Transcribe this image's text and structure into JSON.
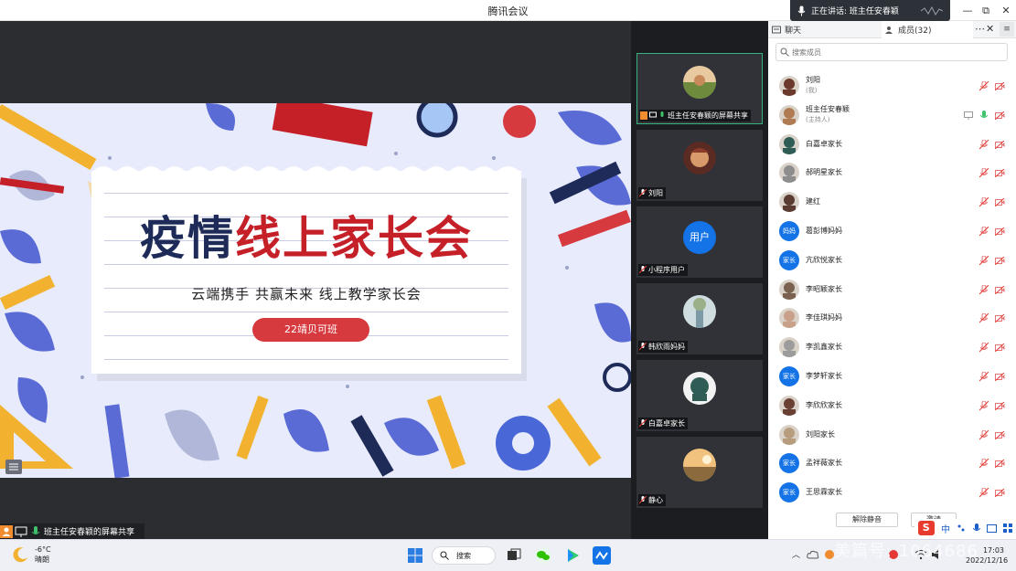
{
  "window": {
    "title": "腾讯会议",
    "speaking_label": "正在讲话: 班主任安春颖",
    "min_glyph": "—",
    "max_glyph": "⧉",
    "close_glyph": "✕"
  },
  "slide": {
    "title_part1": "疫情",
    "title_part2": "线上家长会",
    "subtitle": "云端携手 共赢未来 线上教学家长会",
    "pill": "22靖贝可班"
  },
  "share_bar": {
    "label": "班主任安春颖的屏幕共享"
  },
  "gallery": [
    {
      "name": "班主任安春颖的屏幕共享",
      "type": "photo",
      "color": "#c98a5b"
    },
    {
      "name": "刘阳",
      "type": "photo",
      "color": "#8a3b2a"
    },
    {
      "name": "小程序用户",
      "type": "user",
      "avatar_text": "用户"
    },
    {
      "name": "韩欣雨妈妈",
      "type": "photo",
      "color": "#7c9aa6"
    },
    {
      "name": "白嘉卓家长",
      "type": "photo",
      "color": "#2f5c55"
    },
    {
      "name": "静心",
      "type": "photo",
      "color": "#d9a35a"
    }
  ],
  "panel": {
    "tab_chat": "聊天",
    "tab_members": "成员(32)",
    "more": "⋯",
    "close": "✕",
    "side_btn": "≡",
    "search_placeholder": "搜索成员",
    "members": [
      {
        "name": "刘阳",
        "role": "(我)",
        "avatar": "photo",
        "color": "#6b3a2c"
      },
      {
        "name": "班主任安春颖",
        "role": "(主持人)",
        "avatar": "photo",
        "color": "#b07a52",
        "host": true
      },
      {
        "name": "白嘉卓家长",
        "role": "",
        "avatar": "photo",
        "color": "#2f5c55"
      },
      {
        "name": "郝明星家长",
        "role": "",
        "avatar": "photo",
        "color": "#8d8d8d"
      },
      {
        "name": "建红",
        "role": "",
        "avatar": "photo",
        "color": "#5a3c32"
      },
      {
        "name": "葛彭博妈妈",
        "role": "",
        "avatar": "blue",
        "avatar_text": "妈妈"
      },
      {
        "name": "亢欣悦家长",
        "role": "",
        "avatar": "blue",
        "avatar_text": "家长"
      },
      {
        "name": "李昭颖家长",
        "role": "",
        "avatar": "photo",
        "color": "#7b6150"
      },
      {
        "name": "李佳琪妈妈",
        "role": "",
        "avatar": "photo",
        "color": "#c9a08a"
      },
      {
        "name": "李凯鑫家长",
        "role": "",
        "avatar": "photo",
        "color": "#9c9c9c"
      },
      {
        "name": "李梦轩家长",
        "role": "",
        "avatar": "blue",
        "avatar_text": "家长"
      },
      {
        "name": "李欣欣家长",
        "role": "",
        "avatar": "photo",
        "color": "#6a4034"
      },
      {
        "name": "刘阳家长",
        "role": "",
        "avatar": "photo",
        "color": "#b89c7e"
      },
      {
        "name": "孟祥薇家长",
        "role": "",
        "avatar": "blue",
        "avatar_text": "家长"
      },
      {
        "name": "王思霖家长",
        "role": "",
        "avatar": "blue",
        "avatar_text": "家长"
      }
    ],
    "foot_btn1": "解除静音",
    "foot_btn2": "邀请"
  },
  "taskbar": {
    "temp": "-6°C",
    "weather": "晴朗",
    "search_label": "搜索",
    "time": "17:03",
    "date": "2022/12/16",
    "tray_chevron": "︿"
  },
  "ime": {
    "logo": "S",
    "lang": "中"
  },
  "watermark": "美篇号: 1064686",
  "colors": {
    "accent_red": "#c52027",
    "title_navy": "#1e2b59",
    "tencent_blue": "#1473e6",
    "active_green": "#36b37e"
  }
}
